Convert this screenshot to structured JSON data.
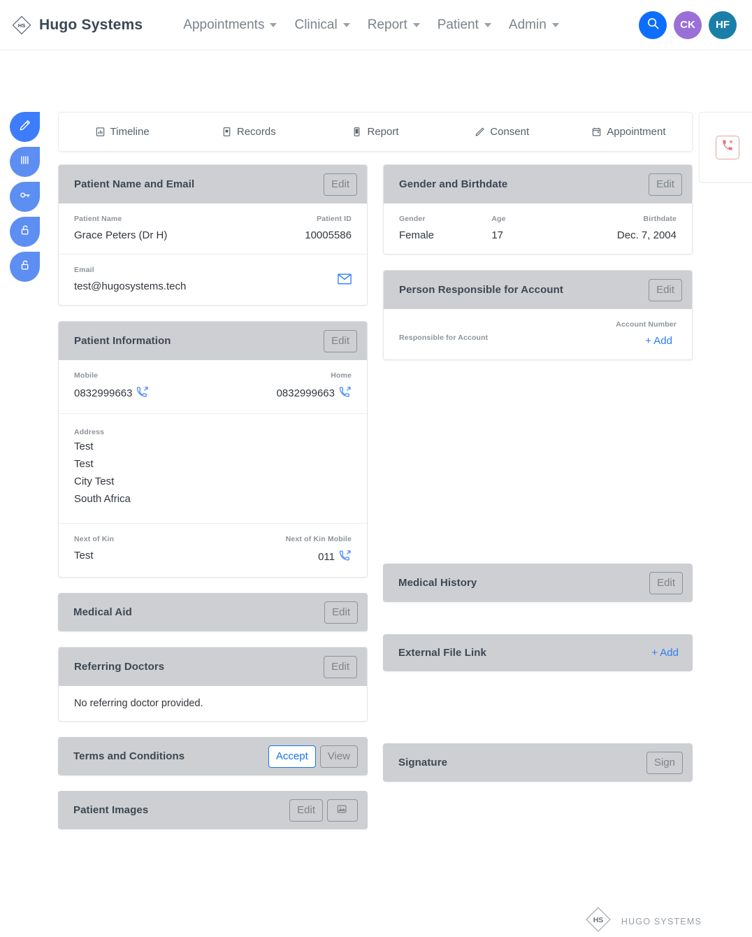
{
  "brand": {
    "mark": "HS",
    "name": "Hugo Systems"
  },
  "navbar": {
    "links": [
      {
        "label": "Appointments",
        "icon": "chevron-down-icon"
      },
      {
        "label": "Clinical",
        "icon": "chevron-down-icon"
      },
      {
        "label": "Report",
        "icon": "chevron-down-icon"
      },
      {
        "label": "Patient",
        "icon": "chevron-down-icon"
      },
      {
        "label": "Admin",
        "icon": "chevron-down-icon"
      }
    ],
    "search": {
      "icon": "search-icon",
      "color": "#0d6efd"
    },
    "avatars": [
      {
        "initials": "CK",
        "color": "#9a6fd8"
      },
      {
        "initials": "HF",
        "color": "#1a7fa8"
      }
    ]
  },
  "rail": {
    "items": [
      {
        "icon": "pencil-icon",
        "color": "#3d7dfc"
      },
      {
        "icon": "barcode-icon",
        "color": "#5d8ef2"
      },
      {
        "icon": "key-icon",
        "color": "#5d8ef2"
      },
      {
        "icon": "unlock-icon",
        "color": "#5d8ef2"
      },
      {
        "icon": "unlock-icon",
        "color": "#5d8ef2"
      }
    ]
  },
  "tabs": [
    {
      "label": "Timeline",
      "icon": "chart-bar-icon"
    },
    {
      "label": "Records",
      "icon": "file-records-icon"
    },
    {
      "label": "Report",
      "icon": "report-icon"
    },
    {
      "label": "Consent",
      "icon": "pen-icon"
    },
    {
      "label": "Appointment",
      "icon": "calendar-icon"
    }
  ],
  "call_panel": {
    "icon": "phone-missed-icon",
    "color": "#e8737f"
  },
  "cards": {
    "patient_name_email": {
      "title": "Patient Name and Email",
      "edit_label": "Edit",
      "patient_name_label": "Patient Name",
      "patient_name_value": "Grace Peters (Dr H)",
      "patient_id_label": "Patient ID",
      "patient_id_value": "10005586",
      "email_label": "Email",
      "email_value": "test@hugosystems.tech",
      "email_icon": "envelope-icon"
    },
    "gender_birthdate": {
      "title": "Gender and Birthdate",
      "edit_label": "Edit",
      "gender_label": "Gender",
      "gender_value": "Female",
      "age_label": "Age",
      "age_value": "17",
      "birthdate_label": "Birthdate",
      "birthdate_value": "Dec. 7, 2004"
    },
    "patient_information": {
      "title": "Patient Information",
      "edit_label": "Edit",
      "mobile_label": "Mobile",
      "mobile_value": "0832999663",
      "home_label": "Home",
      "home_value": "0832999663",
      "address_label": "Address",
      "address_lines": [
        "Test",
        "Test",
        "City Test",
        "South Africa"
      ],
      "next_of_kin_label": "Next of Kin",
      "next_of_kin_value": "Test",
      "next_of_kin_mobile_label": "Next of Kin Mobile",
      "next_of_kin_mobile_value": "011",
      "phone_icon": "phone-outgoing-icon"
    },
    "person_responsible": {
      "title": "Person Responsible for Account",
      "edit_label": "Edit",
      "responsible_label": "Responsible for Account",
      "account_number_label": "Account Number",
      "add_label": "+  Add"
    },
    "medical_aid": {
      "title": "Medical Aid",
      "edit_label": "Edit"
    },
    "medical_history": {
      "title": "Medical History",
      "edit_label": "Edit"
    },
    "referring_doctors": {
      "title": "Referring Doctors",
      "edit_label": "Edit",
      "empty_text": "No referring doctor provided."
    },
    "external_file_link": {
      "title": "External File Link",
      "add_label": "+  Add"
    },
    "terms_conditions": {
      "title": "Terms and Conditions",
      "accept_label": "Accept",
      "view_label": "View"
    },
    "signature": {
      "title": "Signature",
      "sign_label": "Sign"
    },
    "patient_images": {
      "title": "Patient Images",
      "edit_label": "Edit",
      "gallery_icon": "image-icon"
    }
  },
  "footer": {
    "mark": "HS",
    "name": "HUGO SYSTEMS"
  }
}
